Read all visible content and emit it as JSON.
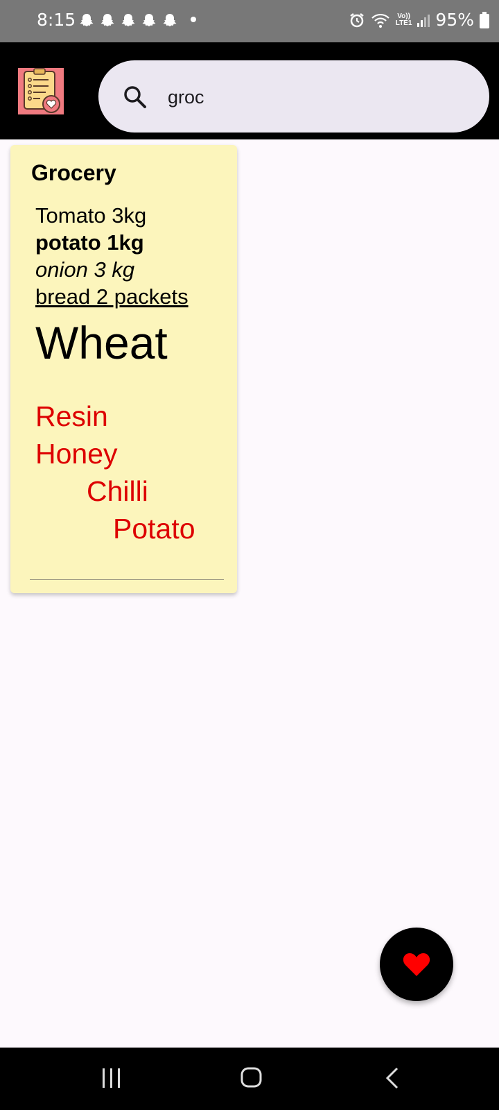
{
  "status_bar": {
    "time": "8:15",
    "notification_icons": [
      "snapchat-icon",
      "snapchat-icon",
      "snapchat-icon",
      "snapchat-icon",
      "snapchat-icon"
    ],
    "network_label_top": "Vo))",
    "network_label_bottom": "LTE1",
    "battery_percent": "95%"
  },
  "app_bar": {
    "logo_icon": "checklist-heart-icon",
    "search": {
      "value": "groc",
      "icon": "search-icon"
    }
  },
  "notes": [
    {
      "title": "Grocery",
      "lines": {
        "tomato": "Tomato 3kg",
        "potato": "potato 1kg",
        "onion": "onion 3 kg",
        "bread": "bread 2 packets",
        "wheat": "Wheat",
        "resin": "Resin",
        "honey": "Honey",
        "chilli": "Chilli",
        "potato_red": "Potato"
      }
    }
  ],
  "fab": {
    "icon": "heart-icon"
  },
  "colors": {
    "card_background": "#fcf5bc",
    "accent_red": "#dd0000",
    "fab_heart": "#ff0000"
  }
}
